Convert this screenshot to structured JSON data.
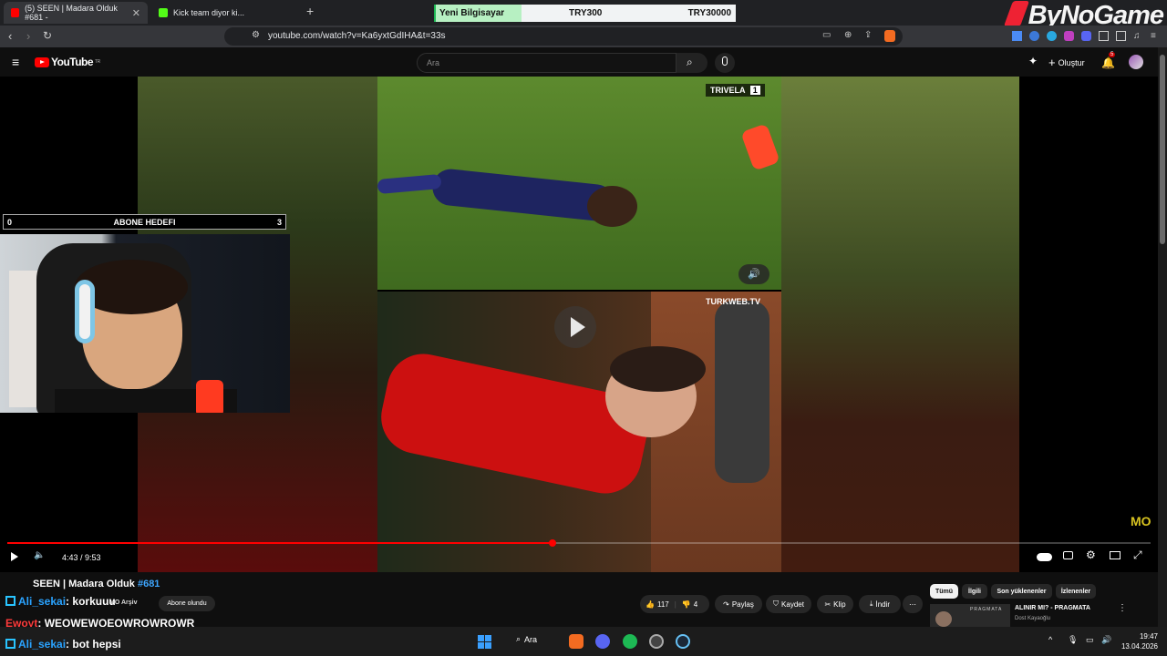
{
  "browser": {
    "tabs": [
      {
        "label": "(5) SEEN | Madara Olduk #681 -",
        "active": true
      },
      {
        "label": "Kick team diyor ki...",
        "active": false
      }
    ],
    "new_tab": "+",
    "url": "youtube.com/watch?v=Ka6yxtGdIHA&t=33s"
  },
  "price_widget": {
    "product": "Yeni Bilgisayar",
    "price_now": "TRY300",
    "price_goal": "TRY30000"
  },
  "brand": {
    "name": "ByNoGame"
  },
  "youtube": {
    "logo": "YouTube",
    "country": "TR",
    "search_placeholder": "Ara",
    "create_label": "Oluştur",
    "notification_count": "5"
  },
  "player": {
    "time": "4:43 / 9:53",
    "progress_fraction": 0.477,
    "watermark_top": "TRIVELA",
    "watermark_top_score": "1",
    "watermark_bottom": "TURKWEB.TV",
    "corner_mark": "MO"
  },
  "stream_overlay": {
    "goal_title": "ABONE HEDEFI",
    "goal_current": "0",
    "goal_target": "3"
  },
  "video": {
    "title": "SEEN | Madara Olduk",
    "title_tag": "#681",
    "channel": "MO Arşiv",
    "subscribe_label": "Abone olundu",
    "likes": "117",
    "dislikes": "4",
    "actions": [
      "Paylaş",
      "Kaydet",
      "Klip",
      "İndir"
    ]
  },
  "chips": [
    "Tümü",
    "İlgili",
    "Son yüklenenler",
    "İzlenenler"
  ],
  "recommendation": {
    "title": "ALINIR MI? - PRAGMATA",
    "channel": "Dost Kayaoğlu",
    "thumb_text": "PRAGMATA"
  },
  "chat": [
    {
      "user": "Ali_sekai",
      "message": "korkuuu",
      "color": "#2aa3ff"
    },
    {
      "user": "Ewoyt",
      "message": "WEQWEWQEQWRQWRQWR",
      "color": "#ff3b3b"
    },
    {
      "user": "Ali_sekai",
      "message": "bot hepsi",
      "color": "#2aa3ff"
    }
  ],
  "taskbar": {
    "search_label": "Ara",
    "time": "19:47",
    "date": "13.04.2026"
  }
}
